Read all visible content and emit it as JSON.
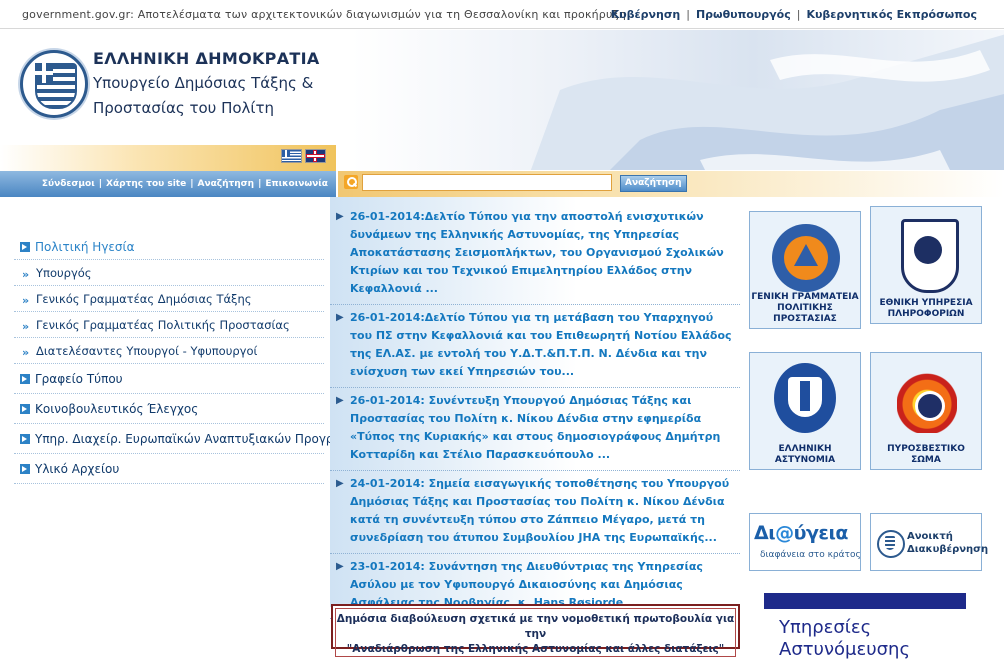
{
  "topbar": {
    "ticker": "government.gov.gr: Αποτελέσματα των αρχιτεκτονικών διαγωνισμών για τη Θεσσαλονίκη και προκήρυξη",
    "links": [
      "Κυβέρνηση",
      "Πρωθυπουργός",
      "Κυβερνητικός Εκπρόσωπος"
    ],
    "separator": "|"
  },
  "header": {
    "republic": "ΕΛΛΗΝΙΚΗ ΔΗΜΟΚΡΑΤΙΑ",
    "ministry_line1": "Υπουργείο Δημόσιας Τάξης &",
    "ministry_line2": "Προστασίας του Πολίτη",
    "languages": [
      "greek-flag-icon",
      "uk-flag-icon"
    ]
  },
  "utility_nav": {
    "links": [
      "Σύνδεσμοι",
      "Χάρτης του site",
      "Αναζήτηση",
      "Επικοινωνία"
    ],
    "separator": "|"
  },
  "search": {
    "value": "",
    "placeholder": "",
    "button_label": "Αναζήτηση"
  },
  "left_menu": {
    "section_title": "Πολιτική Ηγεσία",
    "sub_items": [
      "Υπουργός",
      "Γενικός Γραμματέας Δημόσιας Τάξης",
      "Γενικός Γραμματέας Πολιτικής Προστασίας",
      "Διατελέσαντες Υπουργοί - Υφυπουργοί"
    ],
    "items": [
      "Γραφείο Τύπου",
      "Κοινοβουλευτικός Έλεγχος",
      "Υπηρ. Διαχείρ. Ευρωπαϊκών Αναπτυξιακών Προγρ.",
      "Υλικό Αρχείου"
    ]
  },
  "news": [
    {
      "text": "26-01-2014:Δελτίο Τύπου για την αποστολή ενισχυτικών δυνάμεων της Ελληνικής Αστυνομίας, της Υπηρεσίας Αποκατάστασης Σεισμοπλήκτων, του Οργανισμού Σχολικών Κτιρίων και του Τεχνικού Επιμελητηρίου Ελλάδος στην Κεφαλλονιά ..."
    },
    {
      "text": "26-01-2014:Δελτίο Τύπου για τη μετάβαση του Υπαρχηγού του ΠΣ στην Κεφαλλονιά και του Επιθεωρητή Νοτίου Ελλάδος της ΕΛ.ΑΣ. με εντολή του Υ.Δ.Τ.&Π.Τ.Π. Ν. Δένδια και την ενίσχυση των εκεί Υπηρεσιών του..."
    },
    {
      "text": "26-01-2014: Συνέντευξη Υπουργού Δημόσιας Τάξης και Προστασίας του Πολίτη κ. Νίκου Δένδια στην εφημερίδα «Τύπος της Κυριακής» και στους δημοσιογράφους Δημήτρη Κοτταρίδη και Στέλιο Παρασκευόπουλο ..."
    },
    {
      "text": "24-01-2014: Σημεία εισαγωγικής τοποθέτησης του Υπουργού Δημόσιας Τάξης και Προστασίας του Πολίτη κ. Νίκου Δένδια κατά τη συνέντευξη τύπου στο Ζάππειο Μέγαρο, μετά τη συνεδρίαση του άτυπου Συμβουλίου JHA της Ευρωπαϊκής..."
    },
    {
      "text": "23-01-2014: Συνάντηση της Διευθύντριας της Υπηρεσίας Ασύλου με τον Υφυπουργό Δικαιοσύνης και Δημόσιας Ασφάλειας της Νορβηγίας, κ. Hans Røsjorde ..."
    }
  ],
  "notice": {
    "line1": "Δημόσια διαβούλευση σχετικά με την νομοθετική πρωτοβουλία για την",
    "line2": "\"Αναδιάρθρωση της Ελληνικής Αστυνομίας και άλλες διατάξεις\""
  },
  "badges": {
    "civil_protection": {
      "caption_line1": "ΓΕΝΙΚΗ ΓΡΑΜΜΑΤΕΙΑ",
      "caption_line2": "ΠΟΛΙΤΙΚΗΣ ΠΡΟΣΤΑΣΙΑΣ",
      "icon": "civil-protection-logo-icon"
    },
    "intelligence": {
      "caption_line1": "ΕΘΝΙΚΗ ΥΠΗΡΕΣΙΑ",
      "caption_line2": "ΠΛΗΡΟΦΟΡΙΩΝ",
      "icon": "intelligence-service-logo-icon"
    },
    "police": {
      "caption_line1": "ΕΛΛΗΝΙΚΗ",
      "caption_line2": "ΑΣΤΥΝΟΜΙΑ",
      "icon": "hellenic-police-logo-icon"
    },
    "fire": {
      "caption_line1": "ΠΥΡΟΣΒΕΣΤΙΚΟ ΣΩΜΑ",
      "icon": "fire-service-logo-icon"
    },
    "diavgeia": {
      "title_a": "Δι",
      "title_at": "@",
      "title_b": "ύγεια",
      "subtitle": "διαφάνεια στο κράτος"
    },
    "open_gov": {
      "line1": "Ανοικτή",
      "line2": "Διακυβέρνηση"
    }
  },
  "services_banner": {
    "line1": "Υπηρεσίες",
    "line2": "Αστυνόμευσης"
  },
  "colors": {
    "brand_blue": "#1c3258",
    "link_blue": "#1478bf",
    "accent_orange": "#f0c35c",
    "nav_blue": "#4a86c2"
  }
}
